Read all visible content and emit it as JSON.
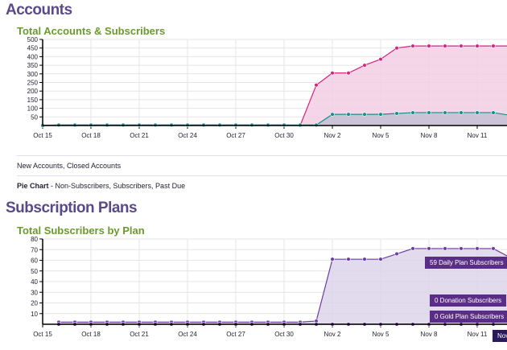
{
  "sections": {
    "accounts": "Accounts",
    "plans": "Subscription Plans"
  },
  "links": {
    "new_closed": "New Accounts, Closed Accounts",
    "pie_bold": "Pie Chart",
    "pie_rest": " - Non-Subscribers, Subscribers, Past Due"
  },
  "chart_data": [
    {
      "type": "area",
      "title": "Total Accounts & Subscribers",
      "ylim": [
        0,
        500
      ],
      "yticks": [
        50,
        100,
        150,
        200,
        250,
        300,
        350,
        400,
        450,
        500
      ],
      "xticks": [
        "Oct 15",
        "Oct 18",
        "Oct 21",
        "Oct 24",
        "Oct 27",
        "Oct 30",
        "Nov 2",
        "Nov 5",
        "Nov 8",
        "Nov 11"
      ],
      "x_days": [
        0,
        1,
        2,
        3,
        4,
        5,
        6,
        7,
        8,
        9,
        10,
        11,
        12,
        13,
        14,
        15,
        16,
        17,
        18,
        19,
        20,
        21,
        22,
        23,
        24,
        25,
        26,
        27,
        28,
        29
      ],
      "series": [
        {
          "name": "Accounts",
          "color": "#d6237e",
          "fill": "#f3cfe4",
          "values": [
            2,
            3,
            3,
            3,
            3,
            3,
            3,
            3,
            3,
            3,
            3,
            3,
            3,
            3,
            3,
            3,
            0,
            235,
            305,
            305,
            350,
            385,
            450,
            462,
            462,
            462,
            462,
            462,
            462,
            462
          ]
        },
        {
          "name": "Subscribers",
          "color": "#14908c",
          "fill": "#c4c0d4",
          "values": [
            0,
            3,
            3,
            3,
            3,
            3,
            3,
            3,
            3,
            3,
            3,
            3,
            3,
            3,
            3,
            3,
            3,
            3,
            65,
            65,
            65,
            65,
            70,
            75,
            75,
            75,
            75,
            75,
            75,
            60
          ]
        }
      ]
    },
    {
      "type": "area",
      "title": "Total Subscribers by Plan",
      "ylim": [
        0,
        80
      ],
      "yticks": [
        10,
        20,
        30,
        40,
        50,
        60,
        70,
        80
      ],
      "xticks": [
        "Oct 15",
        "Oct 18",
        "Oct 21",
        "Oct 24",
        "Oct 27",
        "Oct 30",
        "Nov 2",
        "Nov 5",
        "Nov 8",
        "Nov 11"
      ],
      "x_days": [
        1,
        2,
        3,
        4,
        5,
        6,
        7,
        8,
        9,
        10,
        11,
        12,
        13,
        14,
        15,
        16,
        17,
        18,
        19,
        20,
        21,
        22,
        23,
        24,
        25,
        26,
        27,
        28,
        29
      ],
      "series": [
        {
          "name": "Daily Plan",
          "color": "#6a3ea1",
          "fill": "#ddd3ea",
          "values": [
            2,
            2,
            2,
            2,
            2,
            2,
            2,
            2,
            2,
            2,
            2,
            2,
            2,
            2,
            2,
            2,
            3,
            61,
            61,
            61,
            61,
            66,
            71,
            71,
            71,
            71,
            71,
            71,
            63
          ]
        },
        {
          "name": "Donation",
          "color": "#5a2d86",
          "fill": "none",
          "values": [
            0,
            0,
            0,
            0,
            0,
            0,
            0,
            0,
            0,
            0,
            0,
            0,
            0,
            0,
            0,
            0,
            0,
            0,
            0,
            0,
            0,
            0,
            0,
            0,
            0,
            0,
            0,
            0,
            0
          ]
        }
      ],
      "annotations": [
        "59 Daily Plan Subscribers",
        "0 Donation Subscribers",
        "0 Gold Plan Subscribers",
        "Nov"
      ]
    }
  ]
}
